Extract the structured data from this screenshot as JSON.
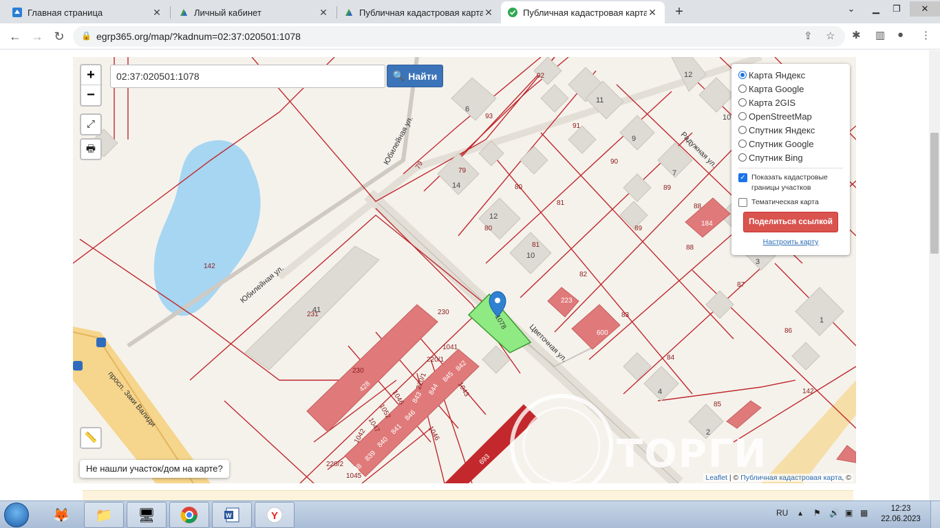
{
  "browser": {
    "tabs": [
      {
        "title": "Главная страница",
        "active": false
      },
      {
        "title": "Личный кабинет",
        "active": false
      },
      {
        "title": "Публичная кадастровая карта",
        "active": false
      },
      {
        "title": "Публичная кадастровая карта -",
        "active": true
      }
    ],
    "new_tab": "+",
    "url": "egrp365.org/map/?kadnum=02:37:020501:1078"
  },
  "map": {
    "search_value": "02:37:020501:1078",
    "search_button": "Найти",
    "zoom_in": "+",
    "zoom_out": "−",
    "layers": {
      "options": [
        "Карта Яндекс",
        "Карта Google",
        "Карта 2GIS",
        "OpenStreetMap",
        "Спутник Яндекс",
        "Спутник Google",
        "Спутник Bing"
      ],
      "selected": "Карта Яндекс",
      "show_borders": "Показать кадастровые границы участков",
      "show_borders_checked": true,
      "thematic": "Тематическая карта",
      "thematic_checked": false,
      "share_button": "Поделиться ссылкой",
      "setup_link": "Настроить карту"
    },
    "not_found_button": "Не нашли участок/дом на карте?",
    "attribution_leaflet": "Leaflet",
    "attribution_sep": " | © ",
    "attribution_pkk": "Публичная кадастровая карта",
    "attribution_tail": ", ©",
    "watermark": "ТОРГИ РОСС",
    "streets": [
      "Юбилейная ул.",
      "Юбилейная ул.",
      "Цветочная ул.",
      "Радужная ул.",
      "просп. Заки Валиди"
    ],
    "parcel_labels": [
      "1078",
      "230",
      "231",
      "142",
      "79",
      "79",
      "80",
      "80",
      "81",
      "81",
      "82",
      "83",
      "84",
      "85",
      "86",
      "87",
      "88",
      "88",
      "89",
      "89",
      "90",
      "91",
      "92",
      "93",
      "1041",
      "1042",
      "1043",
      "1045",
      "1046",
      "1046",
      "1047",
      "1052",
      "842",
      "843",
      "844",
      "845",
      "846",
      "841",
      "840",
      "839",
      "838",
      "220/1",
      "220/1",
      "220/2",
      "428",
      "230",
      "223",
      "600",
      "693",
      "184",
      "142"
    ],
    "house_numbers": [
      "6",
      "14",
      "12",
      "10",
      "11",
      "9",
      "7",
      "12",
      "10",
      "3",
      "1",
      "4",
      "2",
      "41"
    ]
  },
  "taskbar": {
    "lang": "RU",
    "time": "12:23",
    "date": "22.06.2023"
  }
}
